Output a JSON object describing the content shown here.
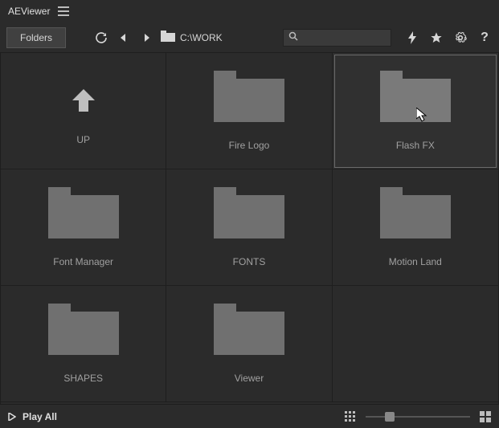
{
  "app": {
    "name": "AEViewer"
  },
  "toolbar": {
    "folders_label": "Folders",
    "path": "C:\\WORK",
    "search": {
      "value": "",
      "placeholder": ""
    }
  },
  "grid": {
    "items": [
      {
        "kind": "up",
        "label": "UP",
        "selected": false
      },
      {
        "kind": "folder",
        "label": "Fire Logo",
        "selected": false
      },
      {
        "kind": "folder",
        "label": "Flash FX",
        "selected": true
      },
      {
        "kind": "folder",
        "label": "Font Manager",
        "selected": false
      },
      {
        "kind": "folder",
        "label": "FONTS",
        "selected": false
      },
      {
        "kind": "folder",
        "label": "Motion Land",
        "selected": false
      },
      {
        "kind": "folder",
        "label": "SHAPES",
        "selected": false
      },
      {
        "kind": "folder",
        "label": "Viewer",
        "selected": false
      }
    ]
  },
  "footer": {
    "play_all": "Play All",
    "slider_value": 20
  },
  "colors": {
    "bg": "#2b2b2b",
    "panel": "#3a3a3a",
    "border": "#1e1e1e",
    "folder": "#707070",
    "text": "#c8c8c8",
    "text_dim": "#a0a0a0"
  }
}
